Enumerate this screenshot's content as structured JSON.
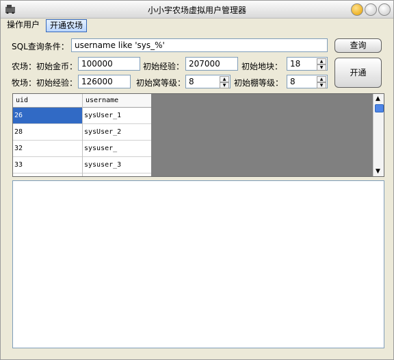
{
  "window": {
    "title": "小小宇农场虚拟用户管理器"
  },
  "menu": {
    "items": [
      "操作用户",
      "开通农场"
    ]
  },
  "form": {
    "sql_label": "SQL查询条件：",
    "sql_value": "username like 'sys_%'",
    "query_button": "查询",
    "open_button": "开通",
    "farm_label": "农场：初始金币：",
    "farm_gold": "100000",
    "farm_exp_label": "初始经验：",
    "farm_exp": "207000",
    "farm_land_label": "初始地块：",
    "farm_land": "18",
    "ranch_label": "牧场：初始经验：",
    "ranch_exp": "126000",
    "ranch_nest_label": "初始窝等级：",
    "ranch_nest": "8",
    "ranch_shed_label": "初始棚等级：",
    "ranch_shed": "8"
  },
  "table": {
    "columns": [
      "uid",
      "username"
    ],
    "rows": [
      [
        "26",
        "sysUser_1"
      ],
      [
        "28",
        "sysUser_2"
      ],
      [
        "32",
        "sysuser_"
      ],
      [
        "33",
        "sysuser_3"
      ]
    ]
  }
}
